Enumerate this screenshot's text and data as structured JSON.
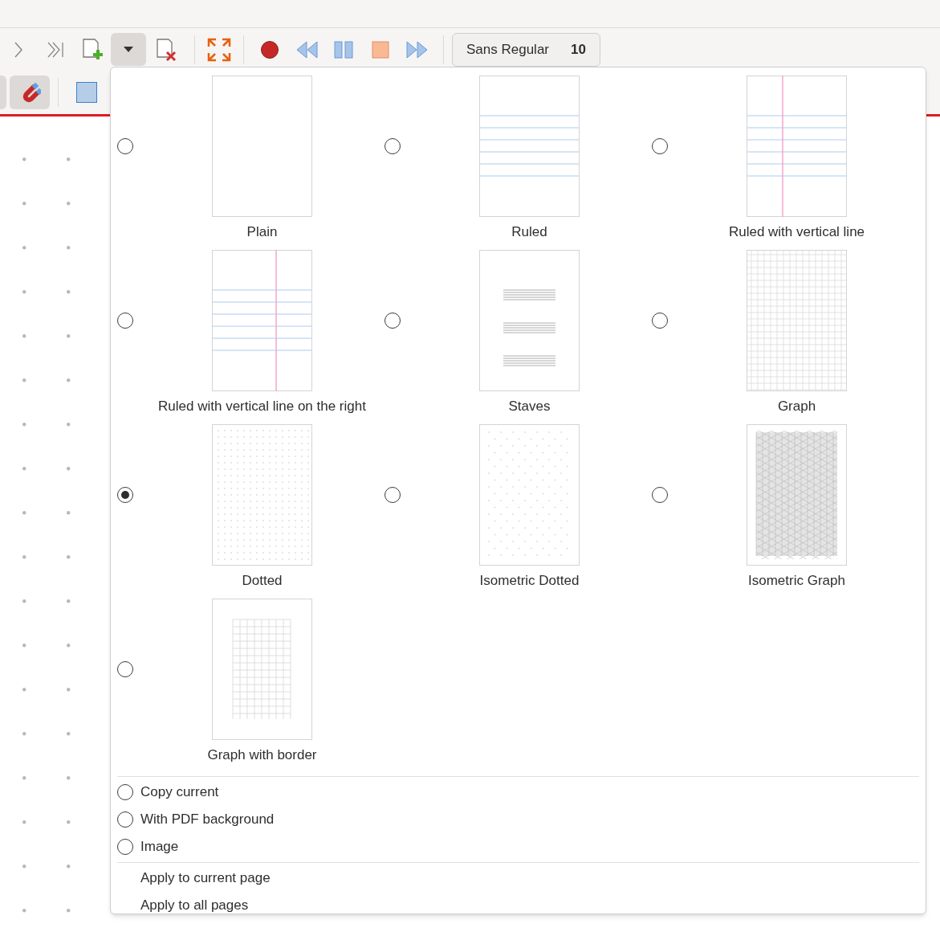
{
  "toolbar": {
    "font_button": {
      "family": "Sans Regular",
      "size": "10"
    }
  },
  "background_menu": {
    "templates": [
      {
        "kind": "plain",
        "label": "Plain",
        "selected": false
      },
      {
        "kind": "ruled",
        "label": "Ruled",
        "selected": false
      },
      {
        "kind": "ruled_vline",
        "label": "Ruled with vertical line",
        "selected": false
      },
      {
        "kind": "ruled_vline_right",
        "label": "Ruled with vertical line on the right",
        "selected": false
      },
      {
        "kind": "staves",
        "label": "Staves",
        "selected": false
      },
      {
        "kind": "graph",
        "label": "Graph",
        "selected": false
      },
      {
        "kind": "dotted",
        "label": "Dotted",
        "selected": true
      },
      {
        "kind": "iso_dotted",
        "label": "Isometric Dotted",
        "selected": false
      },
      {
        "kind": "iso_graph",
        "label": "Isometric Graph",
        "selected": false
      },
      {
        "kind": "graph_border",
        "label": "Graph with border",
        "selected": false
      }
    ],
    "options": [
      {
        "label": "Copy current",
        "selected": false
      },
      {
        "label": "With PDF background",
        "selected": false
      },
      {
        "label": "Image",
        "selected": false
      }
    ],
    "actions": [
      "Apply to current page",
      "Apply to all pages"
    ]
  }
}
